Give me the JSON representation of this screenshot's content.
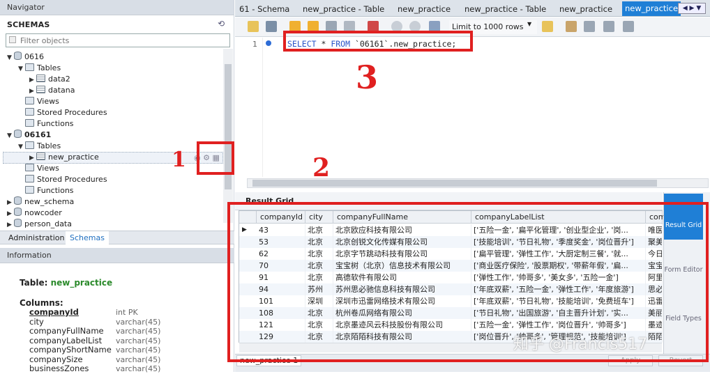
{
  "navigator": {
    "header": "Navigator",
    "schemas_label": "SCHEMAS",
    "filter_placeholder": "Filter objects",
    "tree": [
      {
        "label": "0616",
        "kind": "db",
        "level": 0,
        "expanded": true
      },
      {
        "label": "Tables",
        "kind": "folder",
        "level": 1,
        "expanded": true
      },
      {
        "label": "data2",
        "kind": "table",
        "level": 2
      },
      {
        "label": "datana",
        "kind": "table",
        "level": 2
      },
      {
        "label": "Views",
        "kind": "folder",
        "level": 1
      },
      {
        "label": "Stored Procedures",
        "kind": "folder",
        "level": 1
      },
      {
        "label": "Functions",
        "kind": "folder",
        "level": 1
      },
      {
        "label": "06161",
        "kind": "db",
        "level": 0,
        "expanded": true,
        "bold": true
      },
      {
        "label": "Tables",
        "kind": "folder",
        "level": 1,
        "expanded": true
      },
      {
        "label": "new_practice",
        "kind": "table",
        "level": 2,
        "selected": true
      },
      {
        "label": "Views",
        "kind": "folder",
        "level": 1
      },
      {
        "label": "Stored Procedures",
        "kind": "folder",
        "level": 1
      },
      {
        "label": "Functions",
        "kind": "folder",
        "level": 1
      },
      {
        "label": "new_schema",
        "kind": "db",
        "level": 0
      },
      {
        "label": "nowcoder",
        "kind": "db",
        "level": 0
      },
      {
        "label": "person_data",
        "kind": "db",
        "level": 0
      }
    ],
    "bottom_tabs": [
      "Administration",
      "Schemas"
    ],
    "active_bottom_tab": "Schemas"
  },
  "information": {
    "header": "Information",
    "table_label": "Table: ",
    "table_name": "new_practice",
    "columns_label": "Columns:",
    "columns": [
      {
        "name": "companyId",
        "type": "int PK",
        "pk": true
      },
      {
        "name": "city",
        "type": "varchar(45)"
      },
      {
        "name": "companyFullName",
        "type": "varchar(45)"
      },
      {
        "name": "companyLabelList",
        "type": "varchar(45)"
      },
      {
        "name": "companyShortName",
        "type": "varchar(45)"
      },
      {
        "name": "companySize",
        "type": "varchar(45)"
      },
      {
        "name": "businessZones",
        "type": "varchar(45)"
      }
    ]
  },
  "editor": {
    "tabs": [
      "61 - Schema",
      "new_practice - Table",
      "new_practice",
      "new_practice - Table",
      "new_practice",
      "new_practice"
    ],
    "active_tab": 5,
    "limit_label": "Limit to 1000 rows",
    "line_number": "1",
    "sql": {
      "kw1": "SELECT",
      "star": " * ",
      "kw2": "FROM",
      "rest": " `06161`.new_practice;"
    }
  },
  "result": {
    "toolbar_label": "Result Grid",
    "columns": [
      "companyId",
      "city",
      "companyFullName",
      "companyLabelList",
      "com"
    ],
    "rows": [
      [
        "43",
        "北京",
        "北京欧应科技有限公司",
        "['五险一金', '扁平化管理', '创业型企业', '岗...",
        "唯医"
      ],
      [
        "53",
        "北京",
        "北京创锐文化传媒有限公司",
        "['技能培训', '节日礼物', '季度奖金', '岗位晋升']",
        "聚美"
      ],
      [
        "62",
        "北京",
        "北京字节跳动科技有限公司",
        "['扁平管理', '弹性工作', '大厨定制三餐', '就...",
        "今日"
      ],
      [
        "70",
        "北京",
        "宝宝树（北京）信息技术有限公司",
        "['商业医疗保险', '股票期权', '带薪年假', '扁...",
        "宝宝"
      ],
      [
        "91",
        "北京",
        "高德软件有限公司",
        "['弹性工作', '帅哥多', '美女多', '五险一金']",
        "阿里"
      ],
      [
        "94",
        "苏州",
        "苏州思必驰信息科技有限公司",
        "['年底双薪', '五险一金', '弹性工作', '年度旅游']",
        "思必"
      ],
      [
        "101",
        "深圳",
        "深圳市迅雷网络技术有限公司",
        "['年底双薪', '节日礼物', '技能培训', '免费班车']",
        "迅雷"
      ],
      [
        "108",
        "北京",
        "杭州卷瓜网络有限公司",
        "['节日礼物', '出国旅游', '自主晋升计划', '实...",
        "美丽"
      ],
      [
        "121",
        "北京",
        "北京墨迹风云科技股份有限公司",
        "['五险一金', '弹性工作', '岗位晋升', '帅哥多']",
        "墨迹"
      ],
      [
        "129",
        "北京",
        "北京陌陌科技有限公司",
        "['岗位晋升', '帅哥多', '管理规范', '技能培训']",
        "陌陌"
      ]
    ],
    "side_buttons": [
      "Result Grid",
      "Form Editor",
      "Field Types"
    ],
    "bottom_tab": "new_practice 1",
    "apply": "Apply",
    "revert": "Revert"
  },
  "annotations": {
    "n1": "1",
    "n2": "2",
    "n3": "3",
    "color": "#e02020"
  },
  "watermark": "知乎 @Francis517"
}
